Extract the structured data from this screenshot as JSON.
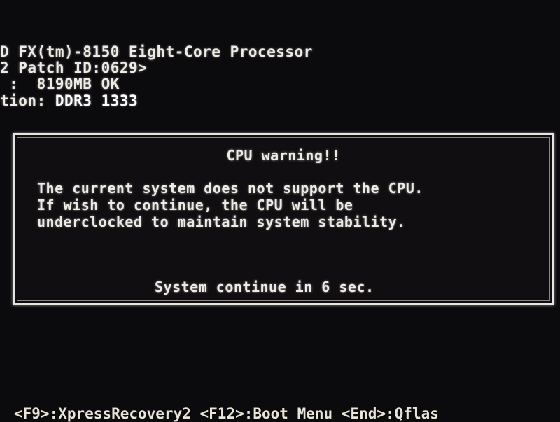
{
  "post_lines": [
    "D FX(tm)-8150 Eight-Core Processor",
    "2 Patch ID:0629>",
    " :  8190MB OK"
  ],
  "memory_line": {
    "label": "tion: ",
    "value": "DDR3 1333"
  },
  "warning": {
    "title": "CPU warning!!",
    "message": [
      "The current system does not support the CPU.",
      "If wish to continue, the CPU will be",
      "underclocked to maintain system stability."
    ],
    "countdown": "System continue in 6 sec."
  },
  "hotkey_bar": "<F9>:XpressRecovery2 <F12>:Boot Menu <End>:Qflas"
}
